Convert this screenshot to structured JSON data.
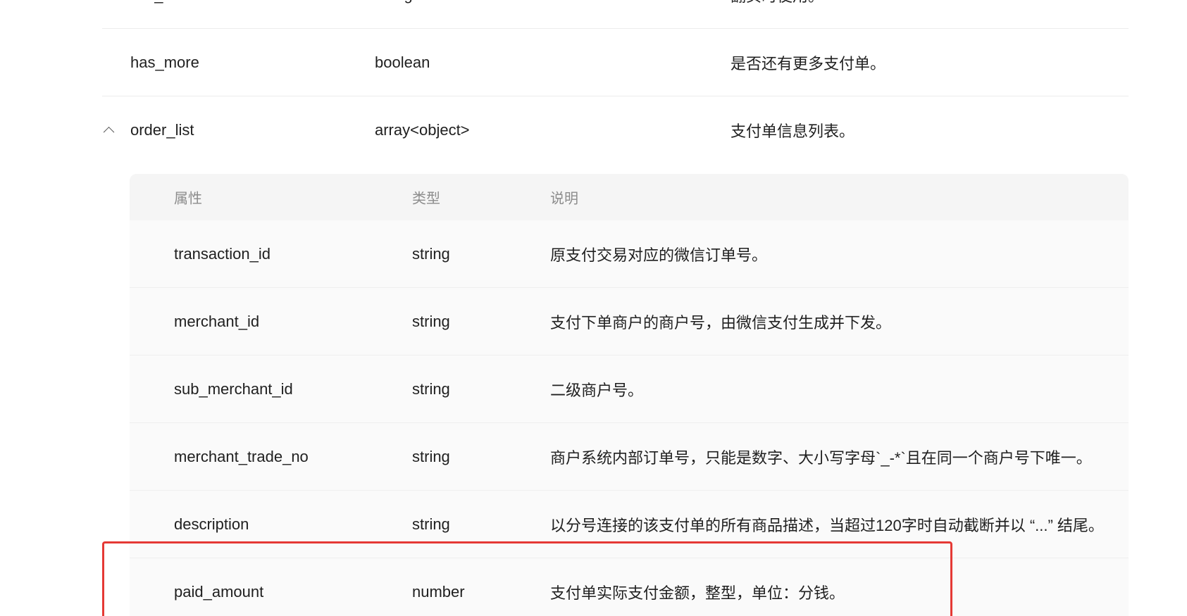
{
  "rows_top": [
    {
      "attr": "last_mark",
      "type": "string",
      "desc": "翻页时使用。"
    },
    {
      "attr": "has_more",
      "type": "boolean",
      "desc": "是否还有更多支付单。"
    },
    {
      "attr": "order_list",
      "type": "array<object>",
      "desc": "支付单信息列表。"
    }
  ],
  "nested": {
    "headers": {
      "attr": "属性",
      "type": "类型",
      "desc": "说明"
    },
    "rows": [
      {
        "attr": "transaction_id",
        "type": "string",
        "desc": "原支付交易对应的微信订单号。"
      },
      {
        "attr": "merchant_id",
        "type": "string",
        "desc": "支付下单商户的商户号，由微信支付生成并下发。"
      },
      {
        "attr": "sub_merchant_id",
        "type": "string",
        "desc": "二级商户号。"
      },
      {
        "attr": "merchant_trade_no",
        "type": "string",
        "desc": "商户系统内部订单号，只能是数字、大小写字母`_-*`且在同一个商户号下唯一。"
      },
      {
        "attr": "description",
        "type": "string",
        "desc": "以分号连接的该支付单的所有商品描述，当超过120字时自动截断并以 “...” 结尾。"
      },
      {
        "attr": "paid_amount",
        "type": "number",
        "desc": "支付单实际支付金额，整型，单位：分钱。"
      }
    ]
  },
  "colors": {
    "highlight": "#e53935",
    "header_text": "#8c8c8c",
    "nested_bg": "#fafafa"
  },
  "icons": {
    "collapse": "chevron-up-icon"
  }
}
